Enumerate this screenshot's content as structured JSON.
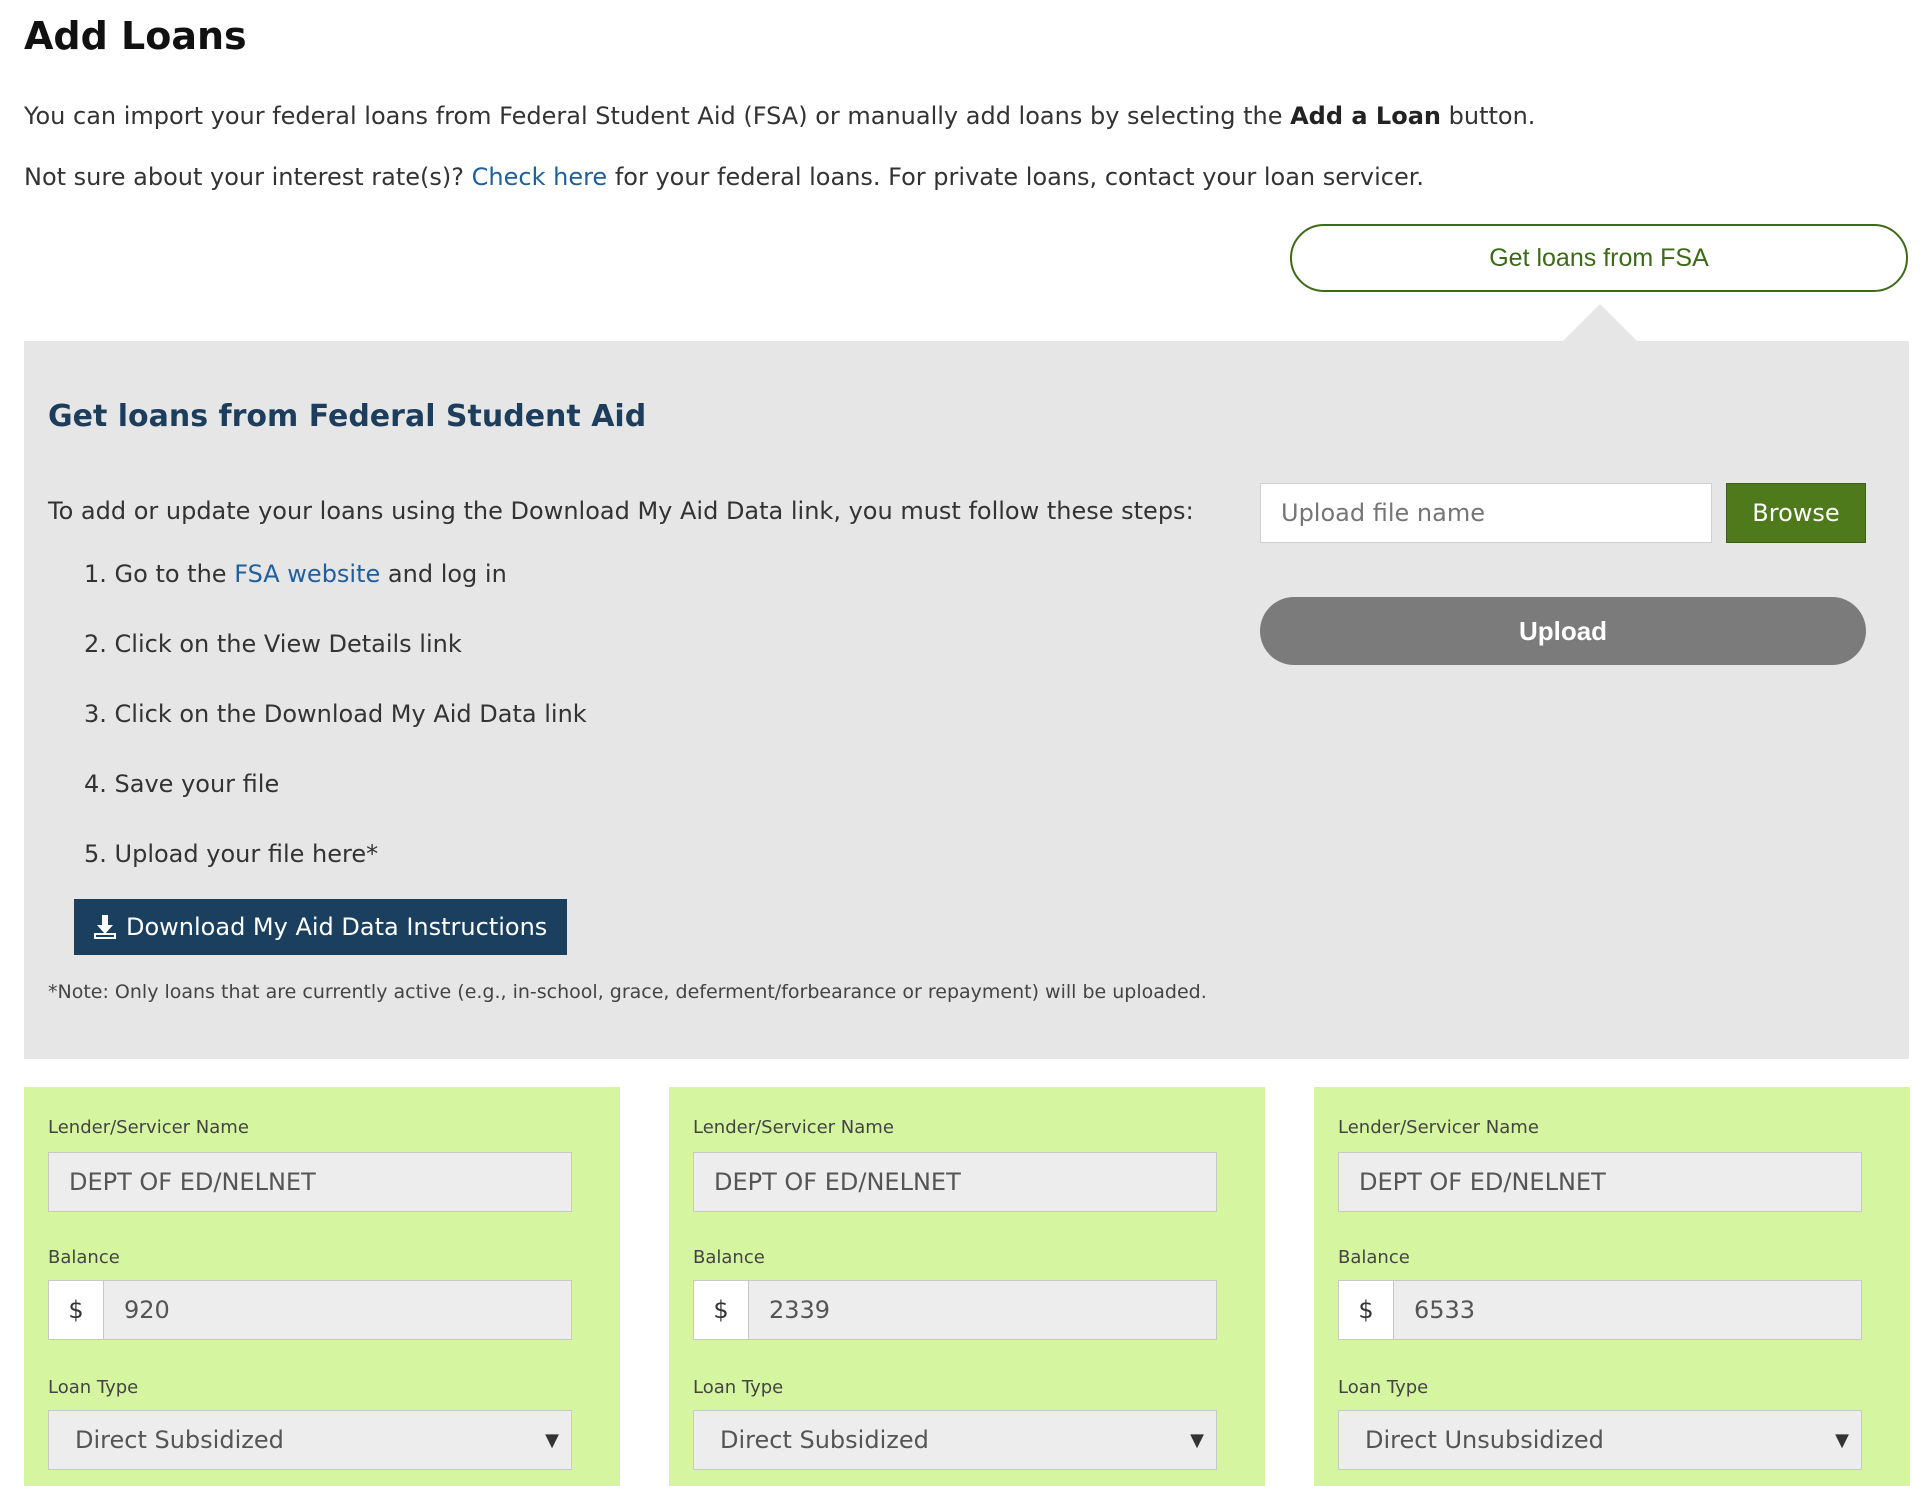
{
  "page": {
    "title": "Add Loans",
    "intro_1_before": "You can import your federal loans from Federal Student Aid (FSA) or manually add loans by selecting the ",
    "intro_1_bold": "Add a Loan",
    "intro_1_after": " button.",
    "intro_2_before": "Not sure about your interest rate(s)? ",
    "intro_2_link": "Check here",
    "intro_2_after": " for your federal loans. For private loans, contact your loan servicer."
  },
  "fsa_toggle": {
    "label": "Get loans from FSA"
  },
  "fsa_panel": {
    "title": "Get loans from Federal Student Aid",
    "steps_intro": "To add or update your loans using the Download My Aid Data link, you must follow these steps:",
    "step1_before": "1. Go to the ",
    "step1_link": "FSA website",
    "step1_after": " and log in",
    "step2": "2. Click on the View Details link",
    "step3": "3. Click on the Download My Aid Data link",
    "step4": "4. Save your file",
    "step5": "5. Upload your file here*",
    "download_button": "Download My Aid Data Instructions",
    "note": "*Note: Only loans that are currently active (e.g., in-school, grace, deferment/forbearance or repayment) will be uploaded.",
    "upload_placeholder": "Upload file name",
    "browse_label": "Browse",
    "upload_label": "Upload"
  },
  "loans": [
    {
      "lender_label": "Lender/Servicer Name",
      "lender": "DEPT OF ED/NELNET",
      "balance_label": "Balance",
      "currency": "$",
      "balance": "920",
      "type_label": "Loan Type",
      "type": "Direct Subsidized"
    },
    {
      "lender_label": "Lender/Servicer Name",
      "lender": "DEPT OF ED/NELNET",
      "balance_label": "Balance",
      "currency": "$",
      "balance": "2339",
      "type_label": "Loan Type",
      "type": "Direct Subsidized"
    },
    {
      "lender_label": "Lender/Servicer Name",
      "lender": "DEPT OF ED/NELNET",
      "balance_label": "Balance",
      "currency": "$",
      "balance": "6533",
      "type_label": "Loan Type",
      "type": "Direct Unsubsidized"
    }
  ],
  "icons": {
    "download": "download-icon",
    "select_caret": "chevron-down-icon"
  },
  "colors": {
    "accent_green": "#4e7a1c",
    "navy": "#1a3f5f",
    "loan_card_bg": "#d5f5a0",
    "panel_bg": "#e6e6e6"
  }
}
